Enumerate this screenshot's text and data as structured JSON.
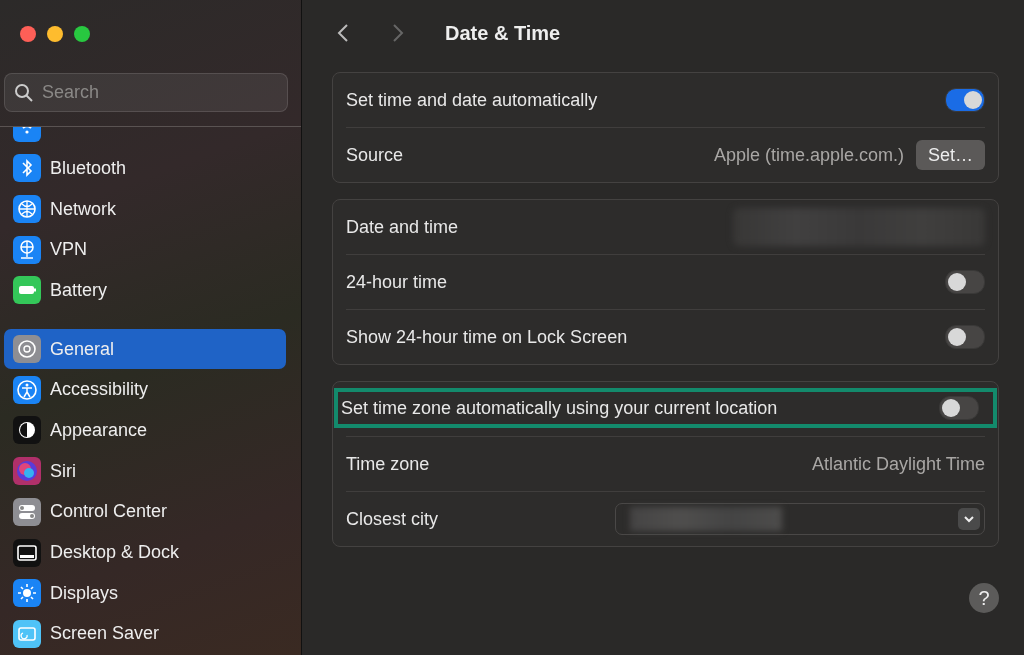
{
  "window": {
    "title": "Date & Time"
  },
  "search": {
    "placeholder": "Search"
  },
  "sidebar": {
    "groups": [
      {
        "items": [
          {
            "label": "Bluetooth",
            "color": "#1a84f5",
            "selected": false
          },
          {
            "label": "Network",
            "color": "#1a84f5",
            "selected": false
          },
          {
            "label": "VPN",
            "color": "#1a84f5",
            "selected": false
          },
          {
            "label": "Battery",
            "color": "#34c759",
            "selected": false
          }
        ]
      },
      {
        "items": [
          {
            "label": "General",
            "color": "#8e8e93",
            "selected": true
          },
          {
            "label": "Accessibility",
            "color": "#1a84f5",
            "selected": false
          },
          {
            "label": "Appearance",
            "color": "#111111",
            "selected": false
          },
          {
            "label": "Siri",
            "color": "#b0306a",
            "selected": false
          },
          {
            "label": "Control Center",
            "color": "#8e8e93",
            "selected": false
          },
          {
            "label": "Desktop & Dock",
            "color": "#111111",
            "selected": false
          },
          {
            "label": "Displays",
            "color": "#1a84f5",
            "selected": false
          },
          {
            "label": "Screen Saver",
            "color": "#4fc3f7",
            "selected": false
          }
        ]
      }
    ]
  },
  "sections": [
    {
      "rows": [
        {
          "kind": "toggle",
          "label": "Set time and date automatically",
          "on": true,
          "highlighted": false
        },
        {
          "kind": "value_button",
          "label": "Source",
          "value": "Apple (time.apple.com.)",
          "button": "Set…",
          "highlighted": false
        }
      ]
    },
    {
      "rows": [
        {
          "kind": "blurred",
          "label": "Date and time",
          "highlighted": false
        },
        {
          "kind": "toggle",
          "label": "24-hour time",
          "on": false,
          "highlighted": false
        },
        {
          "kind": "toggle",
          "label": "Show 24-hour time on Lock Screen",
          "on": false,
          "highlighted": false
        }
      ]
    },
    {
      "rows": [
        {
          "kind": "toggle",
          "label": "Set time zone automatically using your current location",
          "on": false,
          "highlighted": true
        },
        {
          "kind": "value",
          "label": "Time zone",
          "value": "Atlantic Daylight Time",
          "highlighted": false
        },
        {
          "kind": "popup",
          "label": "Closest city",
          "highlighted": false
        }
      ]
    }
  ],
  "help": {
    "label": "?"
  }
}
